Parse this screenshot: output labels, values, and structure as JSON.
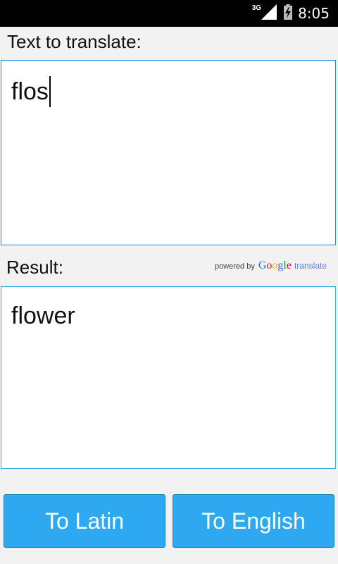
{
  "status_bar": {
    "network_type": "3G",
    "time": "8:05",
    "icons": [
      "signal-icon",
      "battery-charging-icon"
    ]
  },
  "input_section": {
    "label": "Text to translate:",
    "value": "flos"
  },
  "result_section": {
    "label": "Result:",
    "value": "flower",
    "attribution": {
      "powered_by": "powered by",
      "google": [
        "G",
        "o",
        "o",
        "g",
        "l",
        "e"
      ],
      "translate": "translate"
    }
  },
  "buttons": {
    "to_latin": "To Latin",
    "to_english": "To English"
  },
  "colors": {
    "accent": "#2ea8f0",
    "input_border": "#1e88e5",
    "result_border": "#33aadd",
    "background": "#f2f2f2",
    "google_letters": [
      "#3369e8",
      "#d50f25",
      "#eeb211",
      "#3369e8",
      "#009925",
      "#d50f25"
    ]
  }
}
